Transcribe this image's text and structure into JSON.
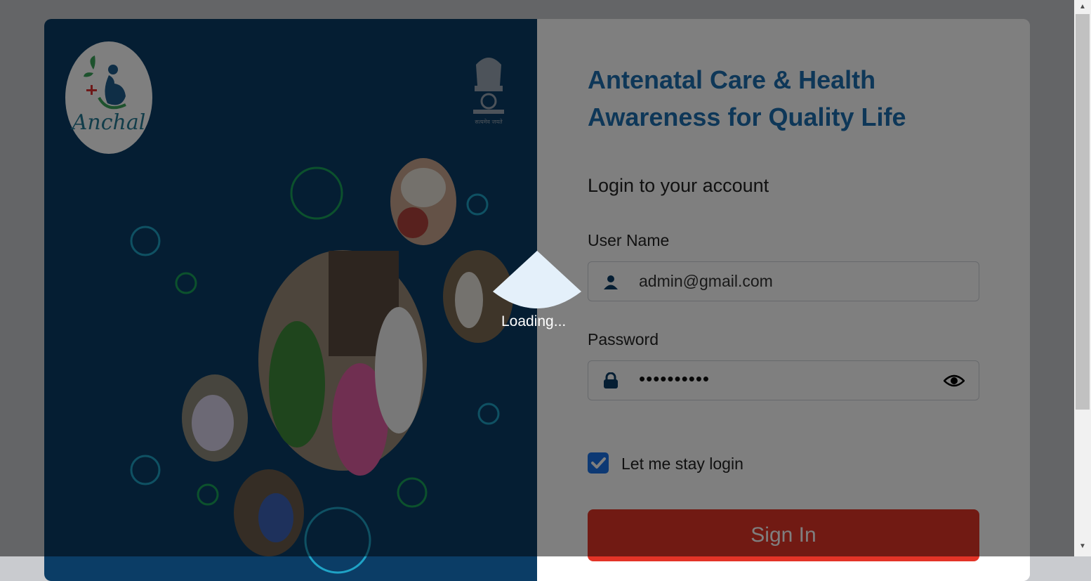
{
  "brand": {
    "logo_text": "Anchal",
    "emblem_motto": "सत्यमेव जयते"
  },
  "headline": "Antenatal Care & Health Awareness for Quality Life",
  "login": {
    "title": "Login to your account",
    "username_label": "User Name",
    "username_value": "admin@gmail.com",
    "password_label": "Password",
    "password_mask": "••••••••••",
    "remember_label": "Let me stay login",
    "remember_checked": true,
    "signin_label": "Sign In"
  },
  "overlay": {
    "loading_text": "Loading..."
  },
  "colors": {
    "panel_blue": "#0b3d66",
    "headline_blue": "#1c6fb0",
    "signin_red": "#e33427",
    "checkbox_blue": "#1a73e8",
    "bubble_green": "#19a35a",
    "bubble_cyan": "#1fa3c6"
  },
  "icons": [
    "user-icon",
    "lock-icon",
    "eye-icon",
    "check-icon",
    "national-emblem-icon",
    "loading-spinner-icon"
  ]
}
